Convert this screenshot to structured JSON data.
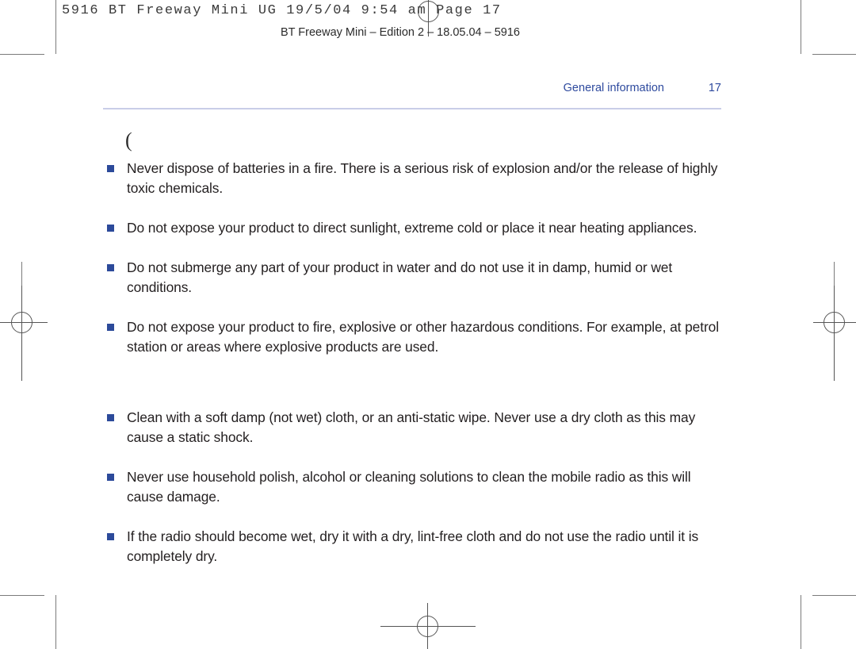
{
  "prepress": {
    "job_line": "5916 BT Freeway Mini UG  19/5/04  9:54 am  Page 17",
    "edition_line": "BT Freeway Mini – Edition 2 – 18.05.04 – 5916"
  },
  "running_head": {
    "section": "General information",
    "page_number": "17"
  },
  "stray_glyph": "(",
  "colors": {
    "heading_blue": "#2e4a9e",
    "bullet_blue": "#2c4a9a",
    "rule_lavender": "#c9cde8",
    "body_text": "#231f20",
    "mark_gray": "#7b7b7b"
  },
  "content": {
    "safety_bullets": [
      "Never dispose of batteries in a fire. There is a serious risk of explosion and/or the release of highly toxic chemicals.",
      "Do not expose your product to direct sunlight, extreme cold or place it near heating appliances.",
      "Do not submerge any part of your product in water and do not use it in damp, humid or wet conditions.",
      "Do not expose your product to fire, explosive or other hazardous conditions. For example, at petrol station or areas where explosive products are used."
    ],
    "cleaning_bullets": [
      "Clean with a soft damp (not wet) cloth, or an anti-static wipe. Never use a dry cloth as this may cause a static shock.",
      "Never use household polish, alcohol or cleaning solutions to clean the mobile radio as this will cause damage.",
      "If the radio should become wet, dry it with a dry, lint-free cloth and do not use the radio until it is completely dry."
    ]
  }
}
